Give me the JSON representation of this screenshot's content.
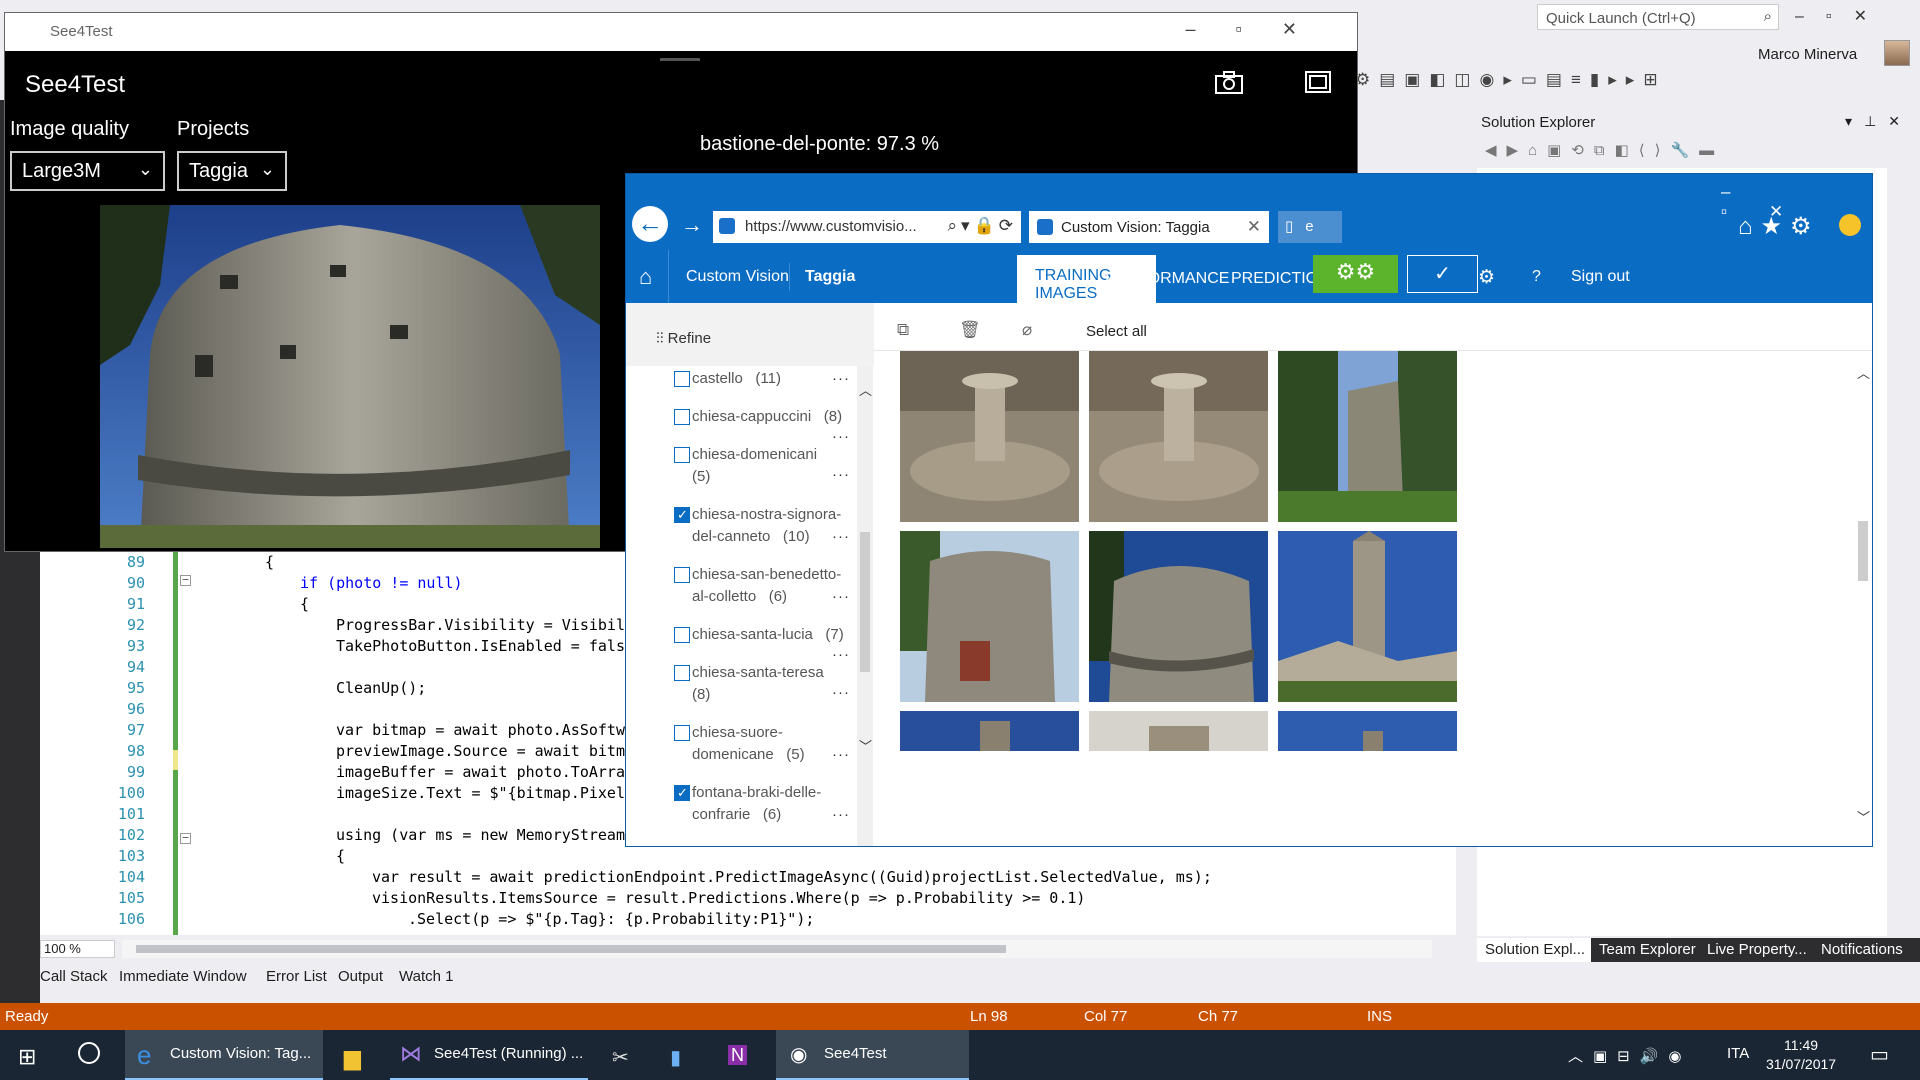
{
  "vs": {
    "quick_launch_placeholder": "Quick Launch (Ctrl+Q)",
    "user_name": "Marco Minerva",
    "status": {
      "ready": "Ready",
      "line": "Ln 98",
      "col": "Col 77",
      "ch": "Ch 77",
      "mode": "INS"
    },
    "zoom": "100 %",
    "tool_tabs": [
      "Call Stack",
      "Immediate Window",
      "Error List",
      "Output",
      "Watch 1"
    ],
    "solution_explorer": {
      "title": "Solution Explorer",
      "tabs": [
        "Solution Expl...",
        "Team Explorer",
        "Live Property...",
        "Notifications"
      ]
    },
    "code_lines": [
      {
        "n": "89",
        "text": "{"
      },
      {
        "n": "90",
        "text": "if (photo != null)"
      },
      {
        "n": "91",
        "text": "{"
      },
      {
        "n": "92",
        "text": "ProgressBar.Visibility = Visibil"
      },
      {
        "n": "93",
        "text": "TakePhotoButton.IsEnabled = fals"
      },
      {
        "n": "94",
        "text": ""
      },
      {
        "n": "95",
        "text": "CleanUp();"
      },
      {
        "n": "96",
        "text": ""
      },
      {
        "n": "97",
        "text": "var bitmap = await photo.AsSoftw"
      },
      {
        "n": "98",
        "text": "previewImage.Source = await bitm"
      },
      {
        "n": "99",
        "text": "imageBuffer = await photo.ToArra"
      },
      {
        "n": "100",
        "text": "imageSize.Text = $\"{bitmap.Pixel"
      },
      {
        "n": "101",
        "text": ""
      },
      {
        "n": "102",
        "text": "using (var ms = new MemoryStream"
      },
      {
        "n": "103",
        "text": "{"
      },
      {
        "n": "104",
        "text": "var result = await predictionEndpoint.PredictImageAsync((Guid)projectList.SelectedValue, ms);"
      },
      {
        "n": "105",
        "text": "visionResults.ItemsSource = result.Predictions.Where(p => p.Probability >= 0.1)"
      },
      {
        "n": "106",
        "text": ".Select(p => $\"{p.Tag}: {p.Probability:P1}\");"
      }
    ]
  },
  "see4test": {
    "window_title": "See4Test",
    "app_title": "See4Test",
    "image_quality_label": "Image quality",
    "image_quality_value": "Large3M",
    "projects_label": "Projects",
    "projects_value": "Taggia",
    "result_text": "bastione-del-ponte: 97.3 %"
  },
  "edge": {
    "address": "https://www.customvisio...",
    "tab_title": "Custom Vision: Taggia"
  },
  "custom_vision": {
    "nav": {
      "brand": "Custom Vision",
      "project": "Taggia",
      "tabs": [
        "TRAINING IMAGES",
        "PERFORMANCE",
        "PREDICTIONS"
      ],
      "sign_out": "Sign out",
      "help": "?"
    },
    "refine_label": "Refine",
    "select_all": "Select all",
    "tags": [
      {
        "line1": "castello",
        "line2": "",
        "count": "(11)",
        "checked": false
      },
      {
        "line1": "chiesa-cappuccini",
        "line2": "",
        "count": "(8)",
        "checked": false
      },
      {
        "line1": "chiesa-domenicani",
        "line2": "",
        "count": "(5)",
        "checked": false
      },
      {
        "line1": "chiesa-nostra-signora-",
        "line2": "del-canneto",
        "count": "(10)",
        "checked": true
      },
      {
        "line1": "chiesa-san-benedetto-",
        "line2": "al-colletto",
        "count": "(6)",
        "checked": false
      },
      {
        "line1": "chiesa-santa-lucia",
        "line2": "",
        "count": "(7)",
        "checked": false
      },
      {
        "line1": "chiesa-santa-teresa",
        "line2": "",
        "count": "(8)",
        "checked": false
      },
      {
        "line1": "chiesa-suore-",
        "line2": "domenicane",
        "count": "(5)",
        "checked": false
      },
      {
        "line1": "fontana-braki-delle-",
        "line2": "confrarie",
        "count": "(6)",
        "checked": true
      }
    ]
  },
  "taskbar": {
    "items": [
      "Custom Vision: Tag...",
      "See4Test (Running) ...",
      "See4Test"
    ],
    "language": "ITA",
    "time": "11:49",
    "date": "31/07/2017"
  }
}
